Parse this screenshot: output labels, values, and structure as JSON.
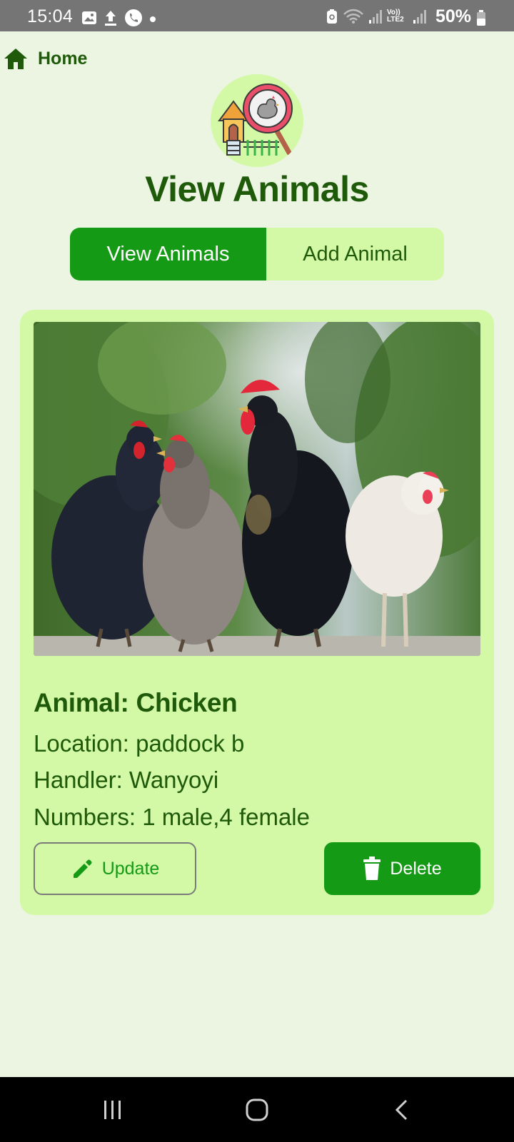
{
  "status_bar": {
    "time": "15:04",
    "battery": "50%",
    "network_label": "Vo)) LTE2"
  },
  "nav": {
    "home_label": "Home"
  },
  "header": {
    "title": "View Animals"
  },
  "tabs": [
    {
      "label": "View Animals",
      "active": true
    },
    {
      "label": "Add Animal",
      "active": false
    }
  ],
  "animal_card": {
    "name": "Animal: Chicken",
    "location": "Location: paddock b",
    "handler": "Handler: Wanyoyi",
    "numbers": "Numbers: 1 male,4 female",
    "update_label": "Update",
    "delete_label": "Delete"
  },
  "colors": {
    "background": "#ebf5e1",
    "card": "#d3f8a6",
    "primary": "#149a15",
    "text": "#1f5a0b",
    "status_bar": "#757575",
    "nav_bar": "#000000"
  },
  "icons": {
    "home": "home-icon",
    "logo": "coop-search-icon",
    "update": "pencil-icon",
    "delete": "trash-icon",
    "nav_recent": "recent-apps-icon",
    "nav_home": "home-circle-icon",
    "nav_back": "back-icon"
  }
}
